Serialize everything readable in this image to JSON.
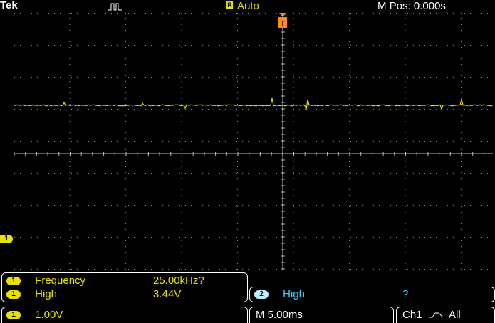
{
  "header": {
    "brand": "Tek",
    "trigger_status": "Auto",
    "horizontal_position": "M Pos: 0.000s"
  },
  "channel_marker": "1",
  "measurements": [
    {
      "channel": "1",
      "name": "Frequency",
      "value": "25.00kHz?"
    },
    {
      "channel": "1",
      "name": "High",
      "value": "3.44V"
    }
  ],
  "measurement_ch2": {
    "channel": "2",
    "name": "High",
    "value": "?"
  },
  "footer": {
    "channel": "1",
    "volts_per_div": "1.00V",
    "timebase": "M 5.00ms",
    "trigger_info": "Ch1",
    "trigger_scope": "All"
  },
  "colors": {
    "ch1": "#e8e200",
    "ch2": "#36d6ff",
    "grid": "#8a8a8a",
    "background": "#000000"
  }
}
